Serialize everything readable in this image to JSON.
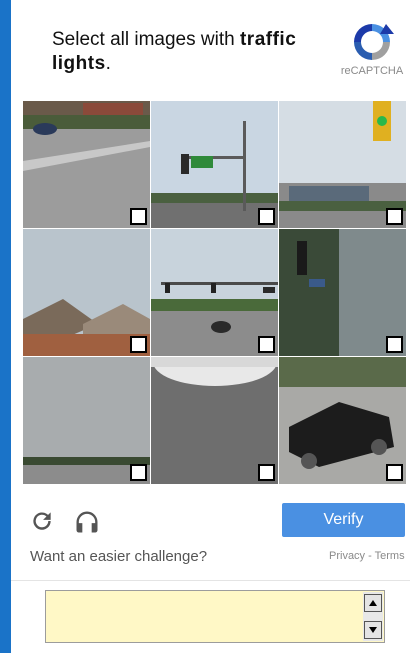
{
  "challenge": {
    "prompt_prefix": "Select all images with ",
    "prompt_target": "traffic lights",
    "prompt_suffix": "."
  },
  "brand": {
    "logo_text": "reCAPTCHA"
  },
  "grid": {
    "tiles": [
      {
        "id": 1,
        "selected": false
      },
      {
        "id": 2,
        "selected": false
      },
      {
        "id": 3,
        "selected": false
      },
      {
        "id": 4,
        "selected": false
      },
      {
        "id": 5,
        "selected": false
      },
      {
        "id": 6,
        "selected": false
      },
      {
        "id": 7,
        "selected": false
      },
      {
        "id": 8,
        "selected": false
      },
      {
        "id": 9,
        "selected": false
      }
    ]
  },
  "controls": {
    "reload_icon": "reload-icon",
    "audio_icon": "headphones-icon",
    "verify_label": "Verify",
    "easier_text": "Want an easier challenge?",
    "privacy_label": "Privacy",
    "separator": " - ",
    "terms_label": "Terms"
  },
  "colors": {
    "verify_bg": "#4a90e2",
    "page_bg": "#1a73c8",
    "answer_box_bg": "#fff8c6"
  }
}
